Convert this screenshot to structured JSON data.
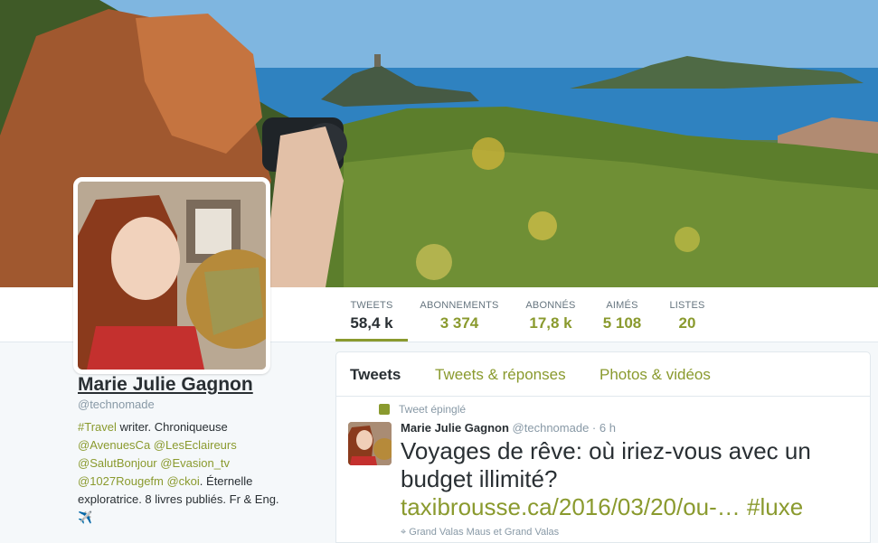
{
  "stats": [
    {
      "label": "TWEETS",
      "value": "58,4 k",
      "active": true
    },
    {
      "label": "ABONNEMENTS",
      "value": "3 374"
    },
    {
      "label": "ABONNÉS",
      "value": "17,8 k"
    },
    {
      "label": "AIMÉS",
      "value": "5 108"
    },
    {
      "label": "LISTES",
      "value": "20"
    }
  ],
  "profile": {
    "name": "Marie Julie Gagnon",
    "handle": "@technomade",
    "bio": {
      "l1_link": "#Travel",
      "l1_text": " writer. Chroniqueuse",
      "l2_link": "@AvenuesCa @LesEclaireurs",
      "l3_link": "@SalutBonjour @Evasion_tv",
      "l4_link": "@1027Rougefm @ckoi",
      "l4_text": ". Éternelle",
      "l5_text": "exploratrice. 8 livres publiés. Fr & Eng.",
      "emoji": "✈️"
    }
  },
  "tabs": [
    {
      "label": "Tweets",
      "active": true
    },
    {
      "label": "Tweets & réponses"
    },
    {
      "label": "Photos & vidéos"
    }
  ],
  "tweet": {
    "pinned_label": "Tweet épinglé",
    "name": "Marie Julie Gagnon",
    "handle": "@technomade",
    "time": " · 6 h",
    "text": "Voyages de rêve: où iriez-vous avec un budget illimité?",
    "link": "taxibrousse.ca/2016/03/20/ou-…",
    "hashtag": "#luxe",
    "location": "Grand Valas Maus et Grand Valas"
  },
  "colors": {
    "accent": "#8a9a2e",
    "text": "#292f33",
    "muted": "#8899a6"
  }
}
